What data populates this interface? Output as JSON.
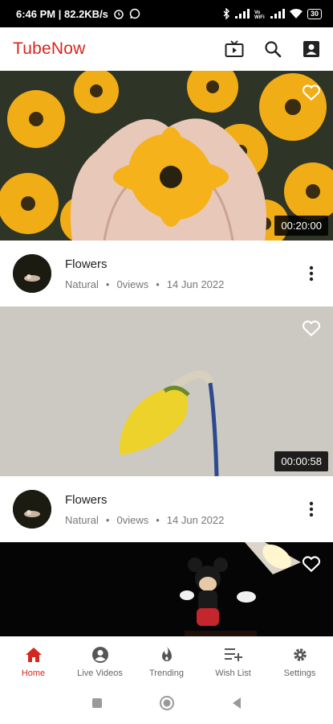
{
  "status_bar": {
    "time_speed": "6:46 PM | 82.2KB/s",
    "battery": "30"
  },
  "app": {
    "title": "TubeNow",
    "actions": [
      "tv-icon",
      "search-icon",
      "account-icon"
    ]
  },
  "videos": [
    {
      "title": "Flowers",
      "category": "Natural",
      "views": "0views",
      "date": "14 Jun 2022",
      "duration": "00:20:00",
      "thumbnail": "hands-holding-yellow-flower"
    },
    {
      "title": "Flowers",
      "category": "Natural",
      "views": "0views",
      "date": "14 Jun 2022",
      "duration": "00:00:58",
      "thumbnail": "yellow-flower-bud"
    },
    {
      "thumbnail": "mickey-figure-under-lamp"
    }
  ],
  "bottom_nav": [
    {
      "label": "Home",
      "icon": "home-icon",
      "active": true
    },
    {
      "label": "Live Videos",
      "icon": "live-icon",
      "active": false
    },
    {
      "label": "Trending",
      "icon": "flame-icon",
      "active": false
    },
    {
      "label": "Wish List",
      "icon": "playlist-add-icon",
      "active": false
    },
    {
      "label": "Settings",
      "icon": "gear-icon",
      "active": false
    }
  ],
  "colors": {
    "brand": "#d7261e",
    "inactive": "#666666"
  }
}
